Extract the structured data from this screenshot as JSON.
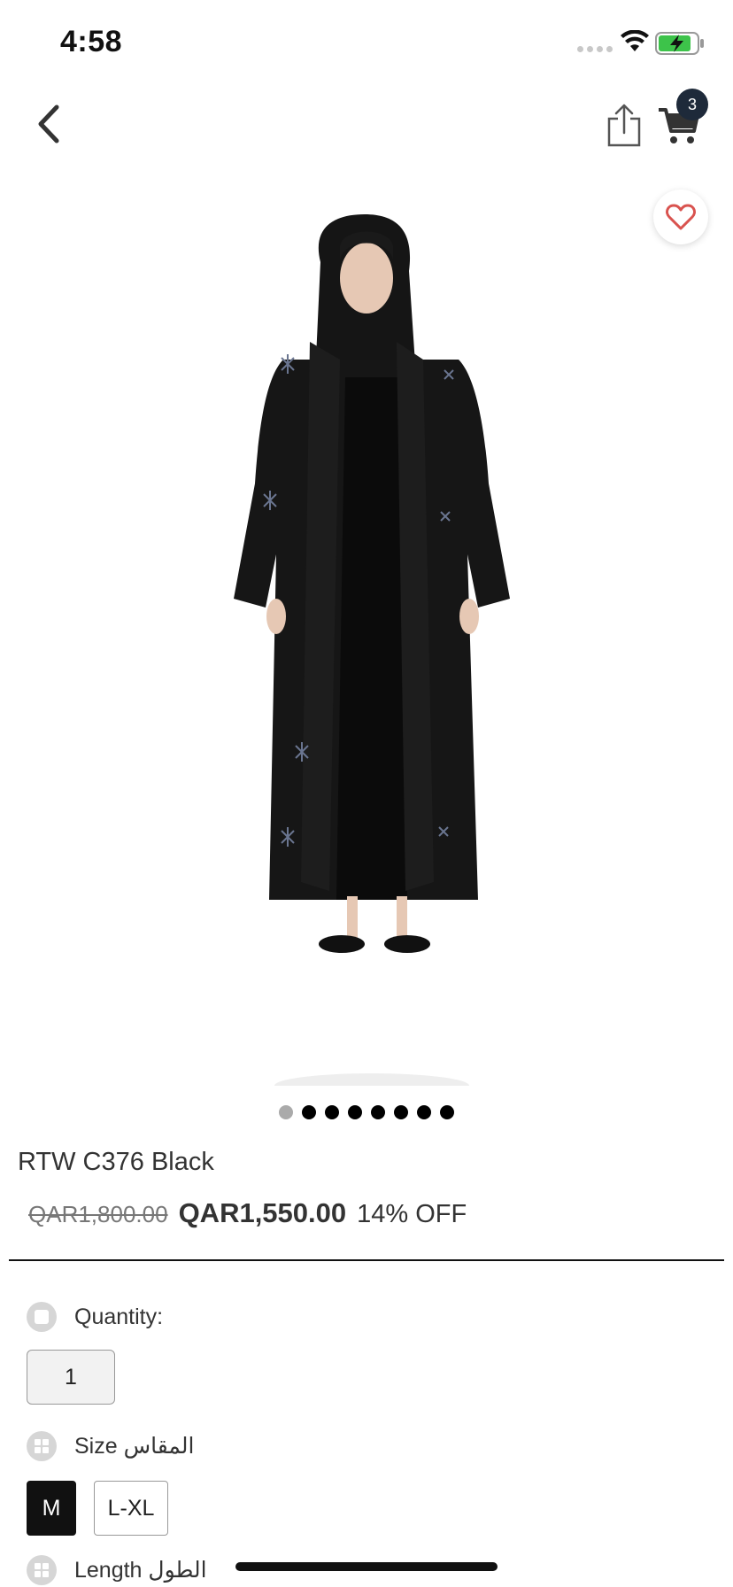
{
  "status_bar": {
    "time": "4:58"
  },
  "nav": {
    "cart_count": "3"
  },
  "pager": {
    "total": 8,
    "active_index": 0
  },
  "product": {
    "title": "RTW C376 Black",
    "price_old": "QAR1,800.00",
    "price_new": "QAR1,550.00",
    "discount": "14% OFF"
  },
  "options": {
    "quantity_label": "Quantity:",
    "quantity_value": "1",
    "size_label": "Size المقاس",
    "sizes": [
      "M",
      "L-XL"
    ],
    "selected_size": "M",
    "length_label": "Length الطول"
  },
  "colors": {
    "favorite_heart": "#d9534f",
    "cart_badge": "#1e2a3a"
  }
}
